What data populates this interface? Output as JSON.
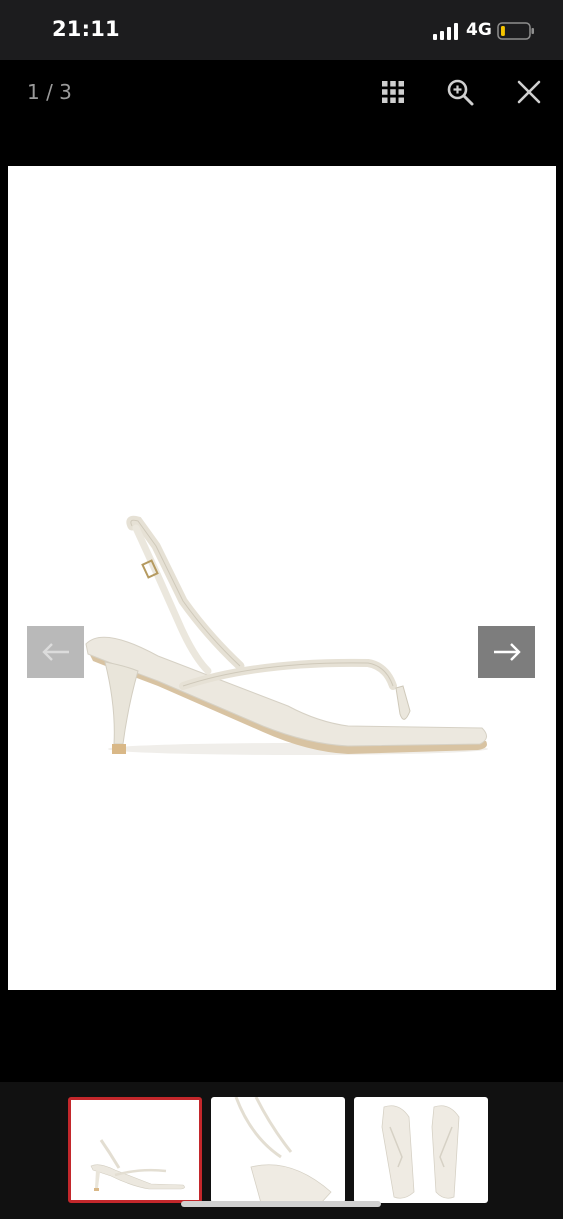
{
  "status_bar": {
    "time": "21:11",
    "network": "4G",
    "battery_level": 0.15,
    "battery_color": "#f5c400"
  },
  "viewer": {
    "counter": "1 / 3",
    "icons": [
      "grid-icon",
      "zoom-in-icon",
      "close-icon"
    ]
  },
  "gallery": {
    "current_index": 1,
    "total": 3,
    "accent_color": "#c3272b",
    "nav": {
      "prev_icon": "arrow-left-icon",
      "next_icon": "arrow-right-icon"
    },
    "thumbnails": [
      {
        "view": "side"
      },
      {
        "view": "close-up"
      },
      {
        "view": "top"
      }
    ]
  }
}
